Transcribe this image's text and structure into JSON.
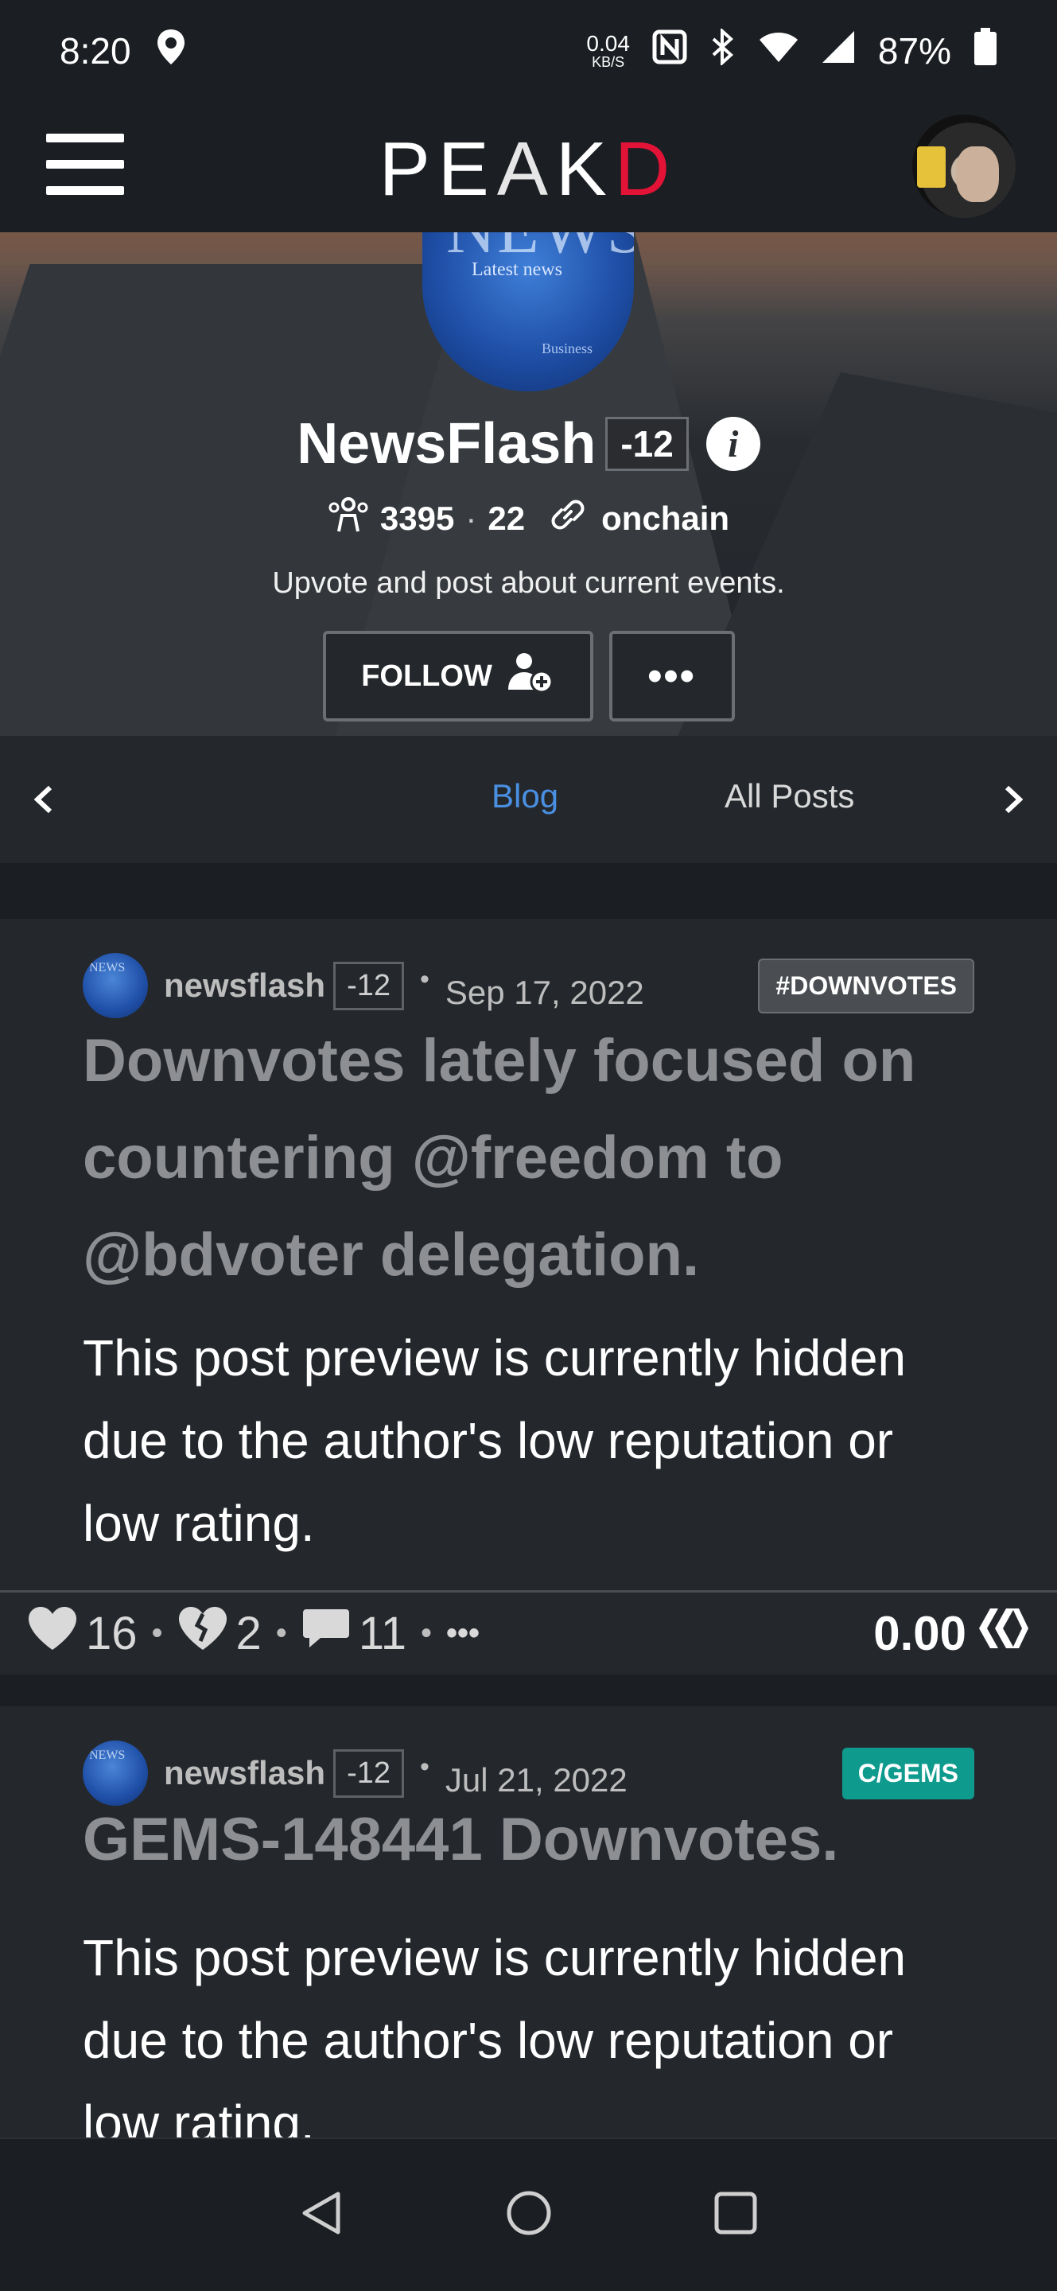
{
  "status_bar": {
    "time": "8:20",
    "net_speed_value": "0.04",
    "net_speed_unit": "KB/S",
    "battery": "87%"
  },
  "app": {
    "logo_prefix": "PE",
    "logo_a": "A",
    "logo_k": "K",
    "logo_d": "D",
    "accent_color": "#e31337"
  },
  "profile": {
    "cover_word": "NEWS",
    "cover_line1": "Latest news",
    "cover_line2": "Business",
    "name": "NewsFlash",
    "reputation": "-12",
    "followers": "3395",
    "following": "22",
    "link": "onchain",
    "bio": "Upvote and post about current events.",
    "follow_label": "FOLLOW",
    "more_label": "•••"
  },
  "tabs": {
    "items": [
      "Blog",
      "All Posts"
    ],
    "active": "Blog",
    "active_color": "#4a90e2"
  },
  "posts": [
    {
      "author": "newsflash",
      "reputation": "-12",
      "date": "Sep 17, 2022",
      "tag": "#DOWNVOTES",
      "title": "Downvotes lately focused on countering @freedom to @bdvoter delegation.",
      "preview": "This post preview is currently hidden due to the author's low reputation or low rating.",
      "upvotes": "16",
      "downvotes": "2",
      "comments": "11",
      "more": "•••",
      "payout": "0.00"
    },
    {
      "author": "newsflash",
      "reputation": "-12",
      "date": "Jul 21, 2022",
      "tag": "C/GEMS",
      "title": "GEMS-148441 Downvotes.",
      "preview": "This post preview is currently hidden due to the author's low reputation or low rating."
    }
  ],
  "icons": {
    "location": "location-pin-icon",
    "nfc": "nfc-icon",
    "bluetooth": "bluetooth-icon",
    "wifi": "wifi-icon",
    "signal": "signal-icon",
    "battery": "battery-icon",
    "menu": "hamburger-menu-icon",
    "info": "info-icon",
    "followers": "followers-icon",
    "link": "link-icon",
    "add_user": "add-user-icon",
    "heart": "heart-icon",
    "broken_heart": "broken-heart-icon",
    "comment": "comment-icon",
    "hive": "hive-logo-icon",
    "back": "nav-back-icon",
    "home": "nav-home-icon",
    "recents": "nav-recents-icon"
  }
}
